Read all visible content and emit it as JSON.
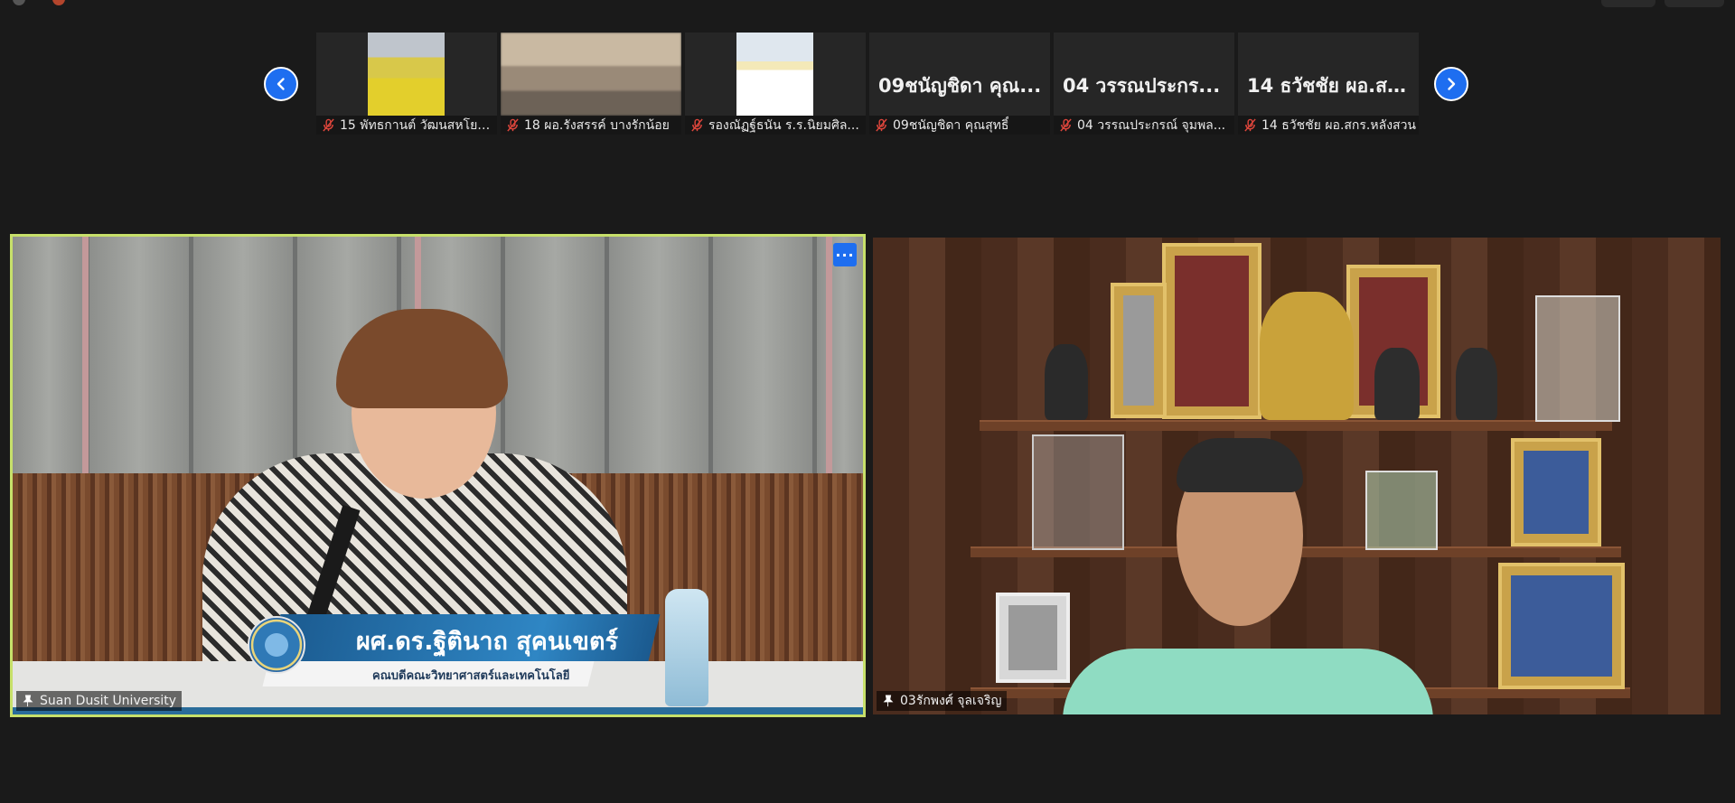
{
  "meeting": {
    "prev_page_label": "Previous page",
    "next_page_label": "Next page"
  },
  "thumbnails": [
    {
      "display": "",
      "label": "15 พัทธกานต์ วัฒนสหโยธิ...",
      "muted": true,
      "video": true
    },
    {
      "display": "",
      "label": "18 ผอ.รังสรรค์ บางรักน้อย",
      "muted": true,
      "video": true
    },
    {
      "display": "",
      "label": "รองณัฏฐ์ธนัน ร.ร.นิยมศิล...",
      "muted": true,
      "video": true
    },
    {
      "display": "09ชนัญชิดา คุณ...",
      "label": "09ชนัญชิดา คุณสุทธิ์",
      "muted": true,
      "video": false
    },
    {
      "display": "04 วรรณประกร...",
      "label": "04 วรรณประกรณ์ จุมพล...",
      "muted": true,
      "video": false
    },
    {
      "display": "14 ธวัชชัย ผอ.สก...",
      "label": "14 ธวัชชัย ผอ.สกร.หลังสวน",
      "muted": true,
      "video": false
    }
  ],
  "main_tiles": [
    {
      "name": "Suan Dusit University",
      "active_speaker": true,
      "pinned": true,
      "lower_third": {
        "name": "ผศ.ดร.ฐิตินาถ สุคนเขตร์",
        "title": "คณบดีคณะวิทยาศาสตร์และเทคโนโลยี"
      }
    },
    {
      "name": "03รักพงศ์ จุลเจริญ",
      "active_speaker": false,
      "pinned": true
    }
  ],
  "colors": {
    "background": "#1a1a1a",
    "accent_blue": "#1e6ef0",
    "active_speaker_border": "#c7e06a",
    "muted_red": "#e0463c"
  },
  "icons": {
    "prev": "chevron-left-icon",
    "next": "chevron-right-icon",
    "muted": "mic-off-icon",
    "pin": "pin-icon",
    "more": "more-options-icon"
  }
}
